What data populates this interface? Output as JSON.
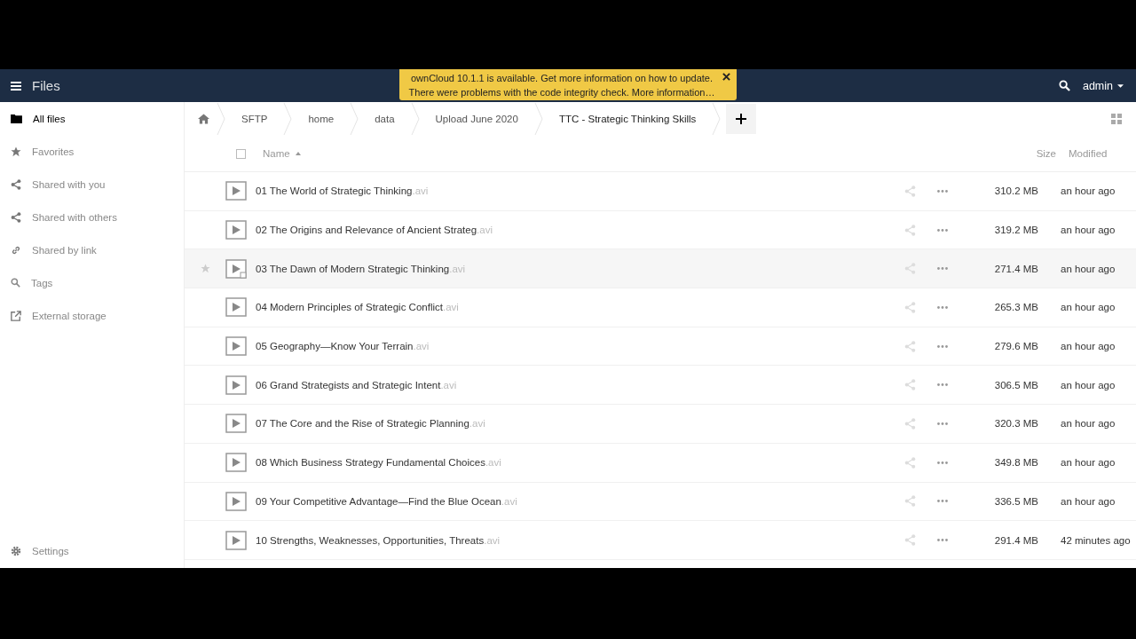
{
  "header": {
    "app_title": "Files",
    "user": "admin"
  },
  "notification": {
    "lines": [
      "ownCloud 10.1.1 is available. Get more information on how to update.",
      "There were problems with the code integrity check. More information…"
    ]
  },
  "sidebar": {
    "items": [
      {
        "label": "All files",
        "selected": true
      },
      {
        "label": "Favorites",
        "selected": false
      },
      {
        "label": "Shared with you",
        "selected": false
      },
      {
        "label": "Shared with others",
        "selected": false
      },
      {
        "label": "Shared by link",
        "selected": false
      },
      {
        "label": "Tags",
        "selected": false
      },
      {
        "label": "External storage",
        "selected": false
      }
    ],
    "settings": "Settings"
  },
  "breadcrumbs": [
    "SFTP",
    "home",
    "data",
    "Upload June 2020",
    "TTC - Strategic Thinking Skills"
  ],
  "table": {
    "columns": [
      "Name",
      "Size",
      "Modified"
    ],
    "select_all_checked": false,
    "rows": [
      {
        "name": "01 The World of Strategic Thinking",
        "ext": ".avi",
        "size": "310.2 MB",
        "modified": "an hour ago",
        "hovered": false
      },
      {
        "name": "02 The Origins and Relevance of Ancient Strateg",
        "ext": ".avi",
        "size": "319.2 MB",
        "modified": "an hour ago",
        "hovered": false
      },
      {
        "name": "03 The Dawn of Modern Strategic Thinking",
        "ext": ".avi",
        "size": "271.4 MB",
        "modified": "an hour ago",
        "hovered": true
      },
      {
        "name": "04 Modern Principles of Strategic Conflict",
        "ext": ".avi",
        "size": "265.3 MB",
        "modified": "an hour ago",
        "hovered": false
      },
      {
        "name": "05 Geography—Know Your Terrain",
        "ext": ".avi",
        "size": "279.6 MB",
        "modified": "an hour ago",
        "hovered": false
      },
      {
        "name": "06 Grand Strategists and Strategic Intent",
        "ext": ".avi",
        "size": "306.5 MB",
        "modified": "an hour ago",
        "hovered": false
      },
      {
        "name": "07 The Core and the Rise of Strategic Planning",
        "ext": ".avi",
        "size": "320.3 MB",
        "modified": "an hour ago",
        "hovered": false
      },
      {
        "name": "08 Which Business Strategy Fundamental Choices",
        "ext": ".avi",
        "size": "349.8 MB",
        "modified": "an hour ago",
        "hovered": false
      },
      {
        "name": "09 Your Competitive Advantage—Find the Blue Ocean",
        "ext": ".avi",
        "size": "336.5 MB",
        "modified": "an hour ago",
        "hovered": false
      },
      {
        "name": "10 Strengths, Weaknesses, Opportunities, Threats",
        "ext": ".avi",
        "size": "291.4 MB",
        "modified": "42 minutes ago",
        "hovered": false
      }
    ]
  }
}
